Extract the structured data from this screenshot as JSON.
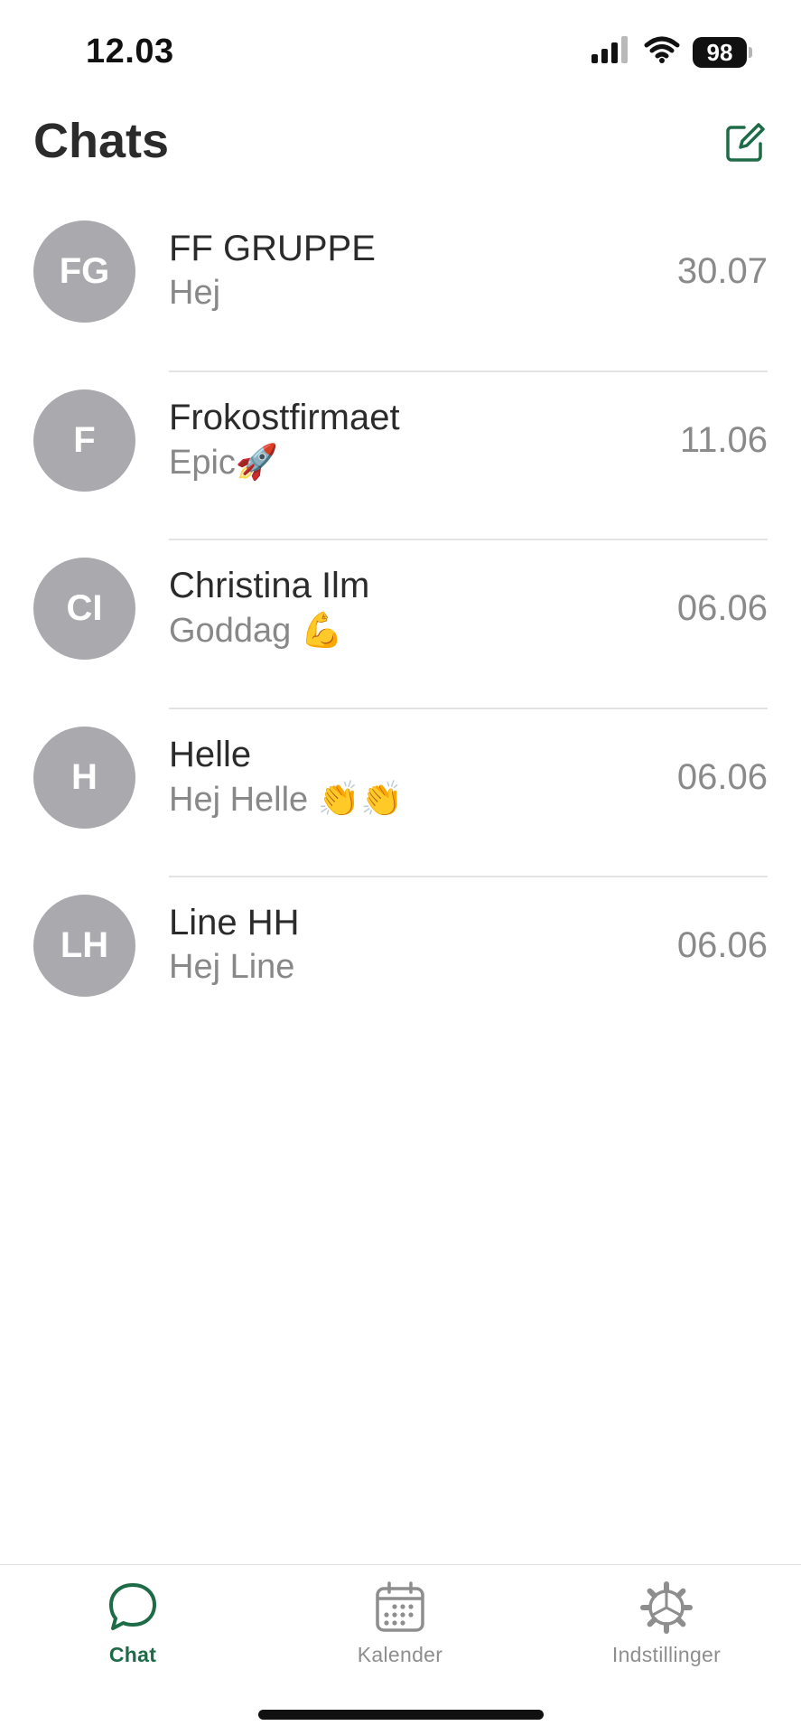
{
  "status_bar": {
    "time": "12.03",
    "battery": "98",
    "icons": [
      "cellular-signal-icon",
      "wifi-icon",
      "battery-icon"
    ]
  },
  "header": {
    "title": "Chats",
    "compose_icon": "compose-icon"
  },
  "colors": {
    "accent": "#1e6b48",
    "avatar": "#a9a9ae",
    "muted": "#8a8a8a"
  },
  "chats": [
    {
      "initials": "FG",
      "name": "FF GRUPPE",
      "preview": "Hej",
      "date": "30.07"
    },
    {
      "initials": "F",
      "name": "Frokostfirmaet",
      "preview": "Epic🚀",
      "date": "11.06"
    },
    {
      "initials": "CI",
      "name": "Christina Ilm",
      "preview": "Goddag 💪",
      "date": "06.06"
    },
    {
      "initials": "H",
      "name": "Helle",
      "preview": "Hej Helle 👏👏",
      "date": "06.06"
    },
    {
      "initials": "LH",
      "name": "Line HH",
      "preview": "Hej Line",
      "date": "06.06"
    }
  ],
  "tabs": [
    {
      "label": "Chat",
      "icon": "chat-bubble-icon",
      "active": true
    },
    {
      "label": "Kalender",
      "icon": "calendar-icon",
      "active": false
    },
    {
      "label": "Indstillinger",
      "icon": "gear-icon",
      "active": false
    }
  ]
}
